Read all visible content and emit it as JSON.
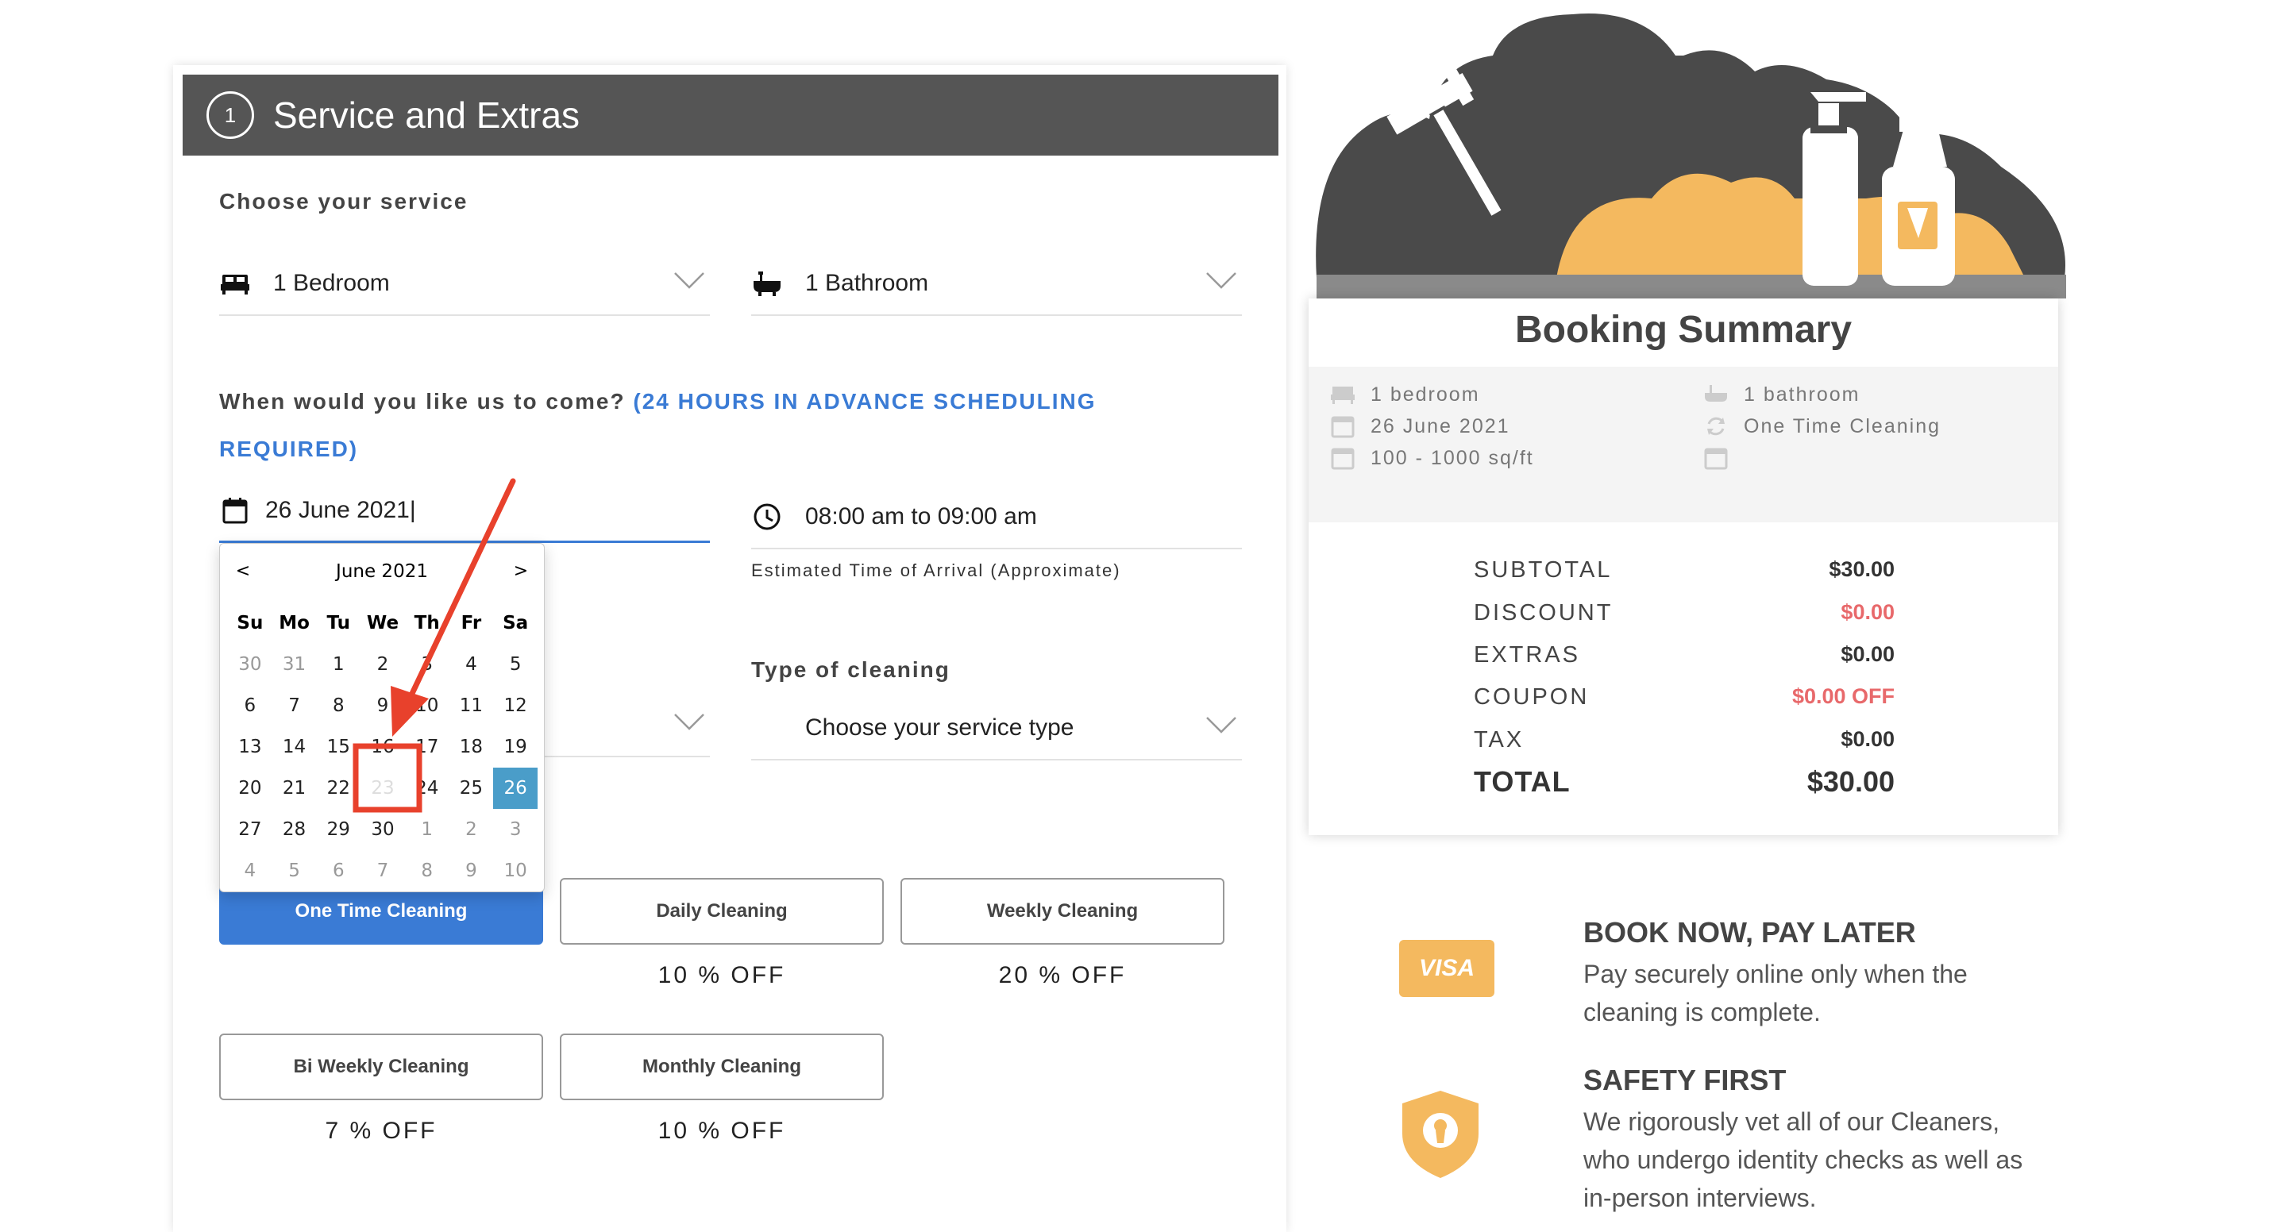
{
  "step": {
    "number": "1",
    "title": "Service and Extras"
  },
  "service": {
    "label": "Choose your service",
    "bedroom": "1 Bedroom",
    "bathroom": "1 Bathroom"
  },
  "schedule": {
    "question": "When would you like us to come?",
    "note_line1": "(24 HOURS IN ADVANCE SCHEDULING",
    "note_line2": "REQUIRED)",
    "date_value": "26 June 2021|",
    "time_value": "08:00 am to 09:00 am",
    "eta_note": "Estimated Time of Arrival (Approximate)"
  },
  "calendar": {
    "prev": "<",
    "next": ">",
    "month": "June 2021",
    "weekdays": [
      "Su",
      "Mo",
      "Tu",
      "We",
      "Th",
      "Fr",
      "Sa"
    ],
    "weeks": [
      [
        "30",
        "31",
        "1",
        "2",
        "3",
        "4",
        "5"
      ],
      [
        "6",
        "7",
        "8",
        "9",
        "10",
        "11",
        "12"
      ],
      [
        "13",
        "14",
        "15",
        "16",
        "17",
        "18",
        "19"
      ],
      [
        "20",
        "21",
        "22",
        "23",
        "24",
        "25",
        "26"
      ],
      [
        "27",
        "28",
        "29",
        "30",
        "1",
        "2",
        "3"
      ],
      [
        "4",
        "5",
        "6",
        "7",
        "8",
        "9",
        "10"
      ]
    ],
    "selected": "26"
  },
  "cleaning_type": {
    "label": "Type of cleaning",
    "placeholder": "Choose your service type"
  },
  "frequency": [
    {
      "label": "One Time Cleaning",
      "discount": "",
      "active": true
    },
    {
      "label": "Daily Cleaning",
      "discount": "10 % OFF",
      "active": false
    },
    {
      "label": "Weekly Cleaning",
      "discount": "20 % OFF",
      "active": false
    },
    {
      "label": "Bi Weekly Cleaning",
      "discount": "7 % OFF",
      "active": false
    },
    {
      "label": "Monthly Cleaning",
      "discount": "10 % OFF",
      "active": false
    }
  ],
  "summary": {
    "title": "Booking Summary",
    "bedroom": "1 bedroom",
    "bathroom": "1 bathroom",
    "date": "26 June 2021",
    "frequency": "One Time Cleaning",
    "area": "100 - 1000 sq/ft",
    "subtotal_label": "SUBTOTAL",
    "subtotal": "$30.00",
    "discount_label": "DISCOUNT",
    "discount": "$0.00",
    "extras_label": "EXTRAS",
    "extras": "$0.00",
    "coupon_label": "COUPON",
    "coupon": "$0.00 OFF",
    "tax_label": "TAX",
    "tax": "$0.00",
    "total_label": "TOTAL",
    "total": "$30.00"
  },
  "features": {
    "visa_label": "VISA",
    "book_title": "BOOK NOW, PAY LATER",
    "book_text": "Pay securely online only when the cleaning is complete.",
    "safety_title": "SAFETY FIRST",
    "safety_text": "We rigorously vet all of our Cleaners, who undergo identity checks as well as in-person interviews."
  },
  "colors": {
    "header_bg": "#555555",
    "accent_blue": "#3a7bd5",
    "selected_day": "#4a9dc9",
    "discount_red": "#e8696b",
    "brand_orange": "#f4b95f",
    "annotation_red": "#e8412c"
  }
}
